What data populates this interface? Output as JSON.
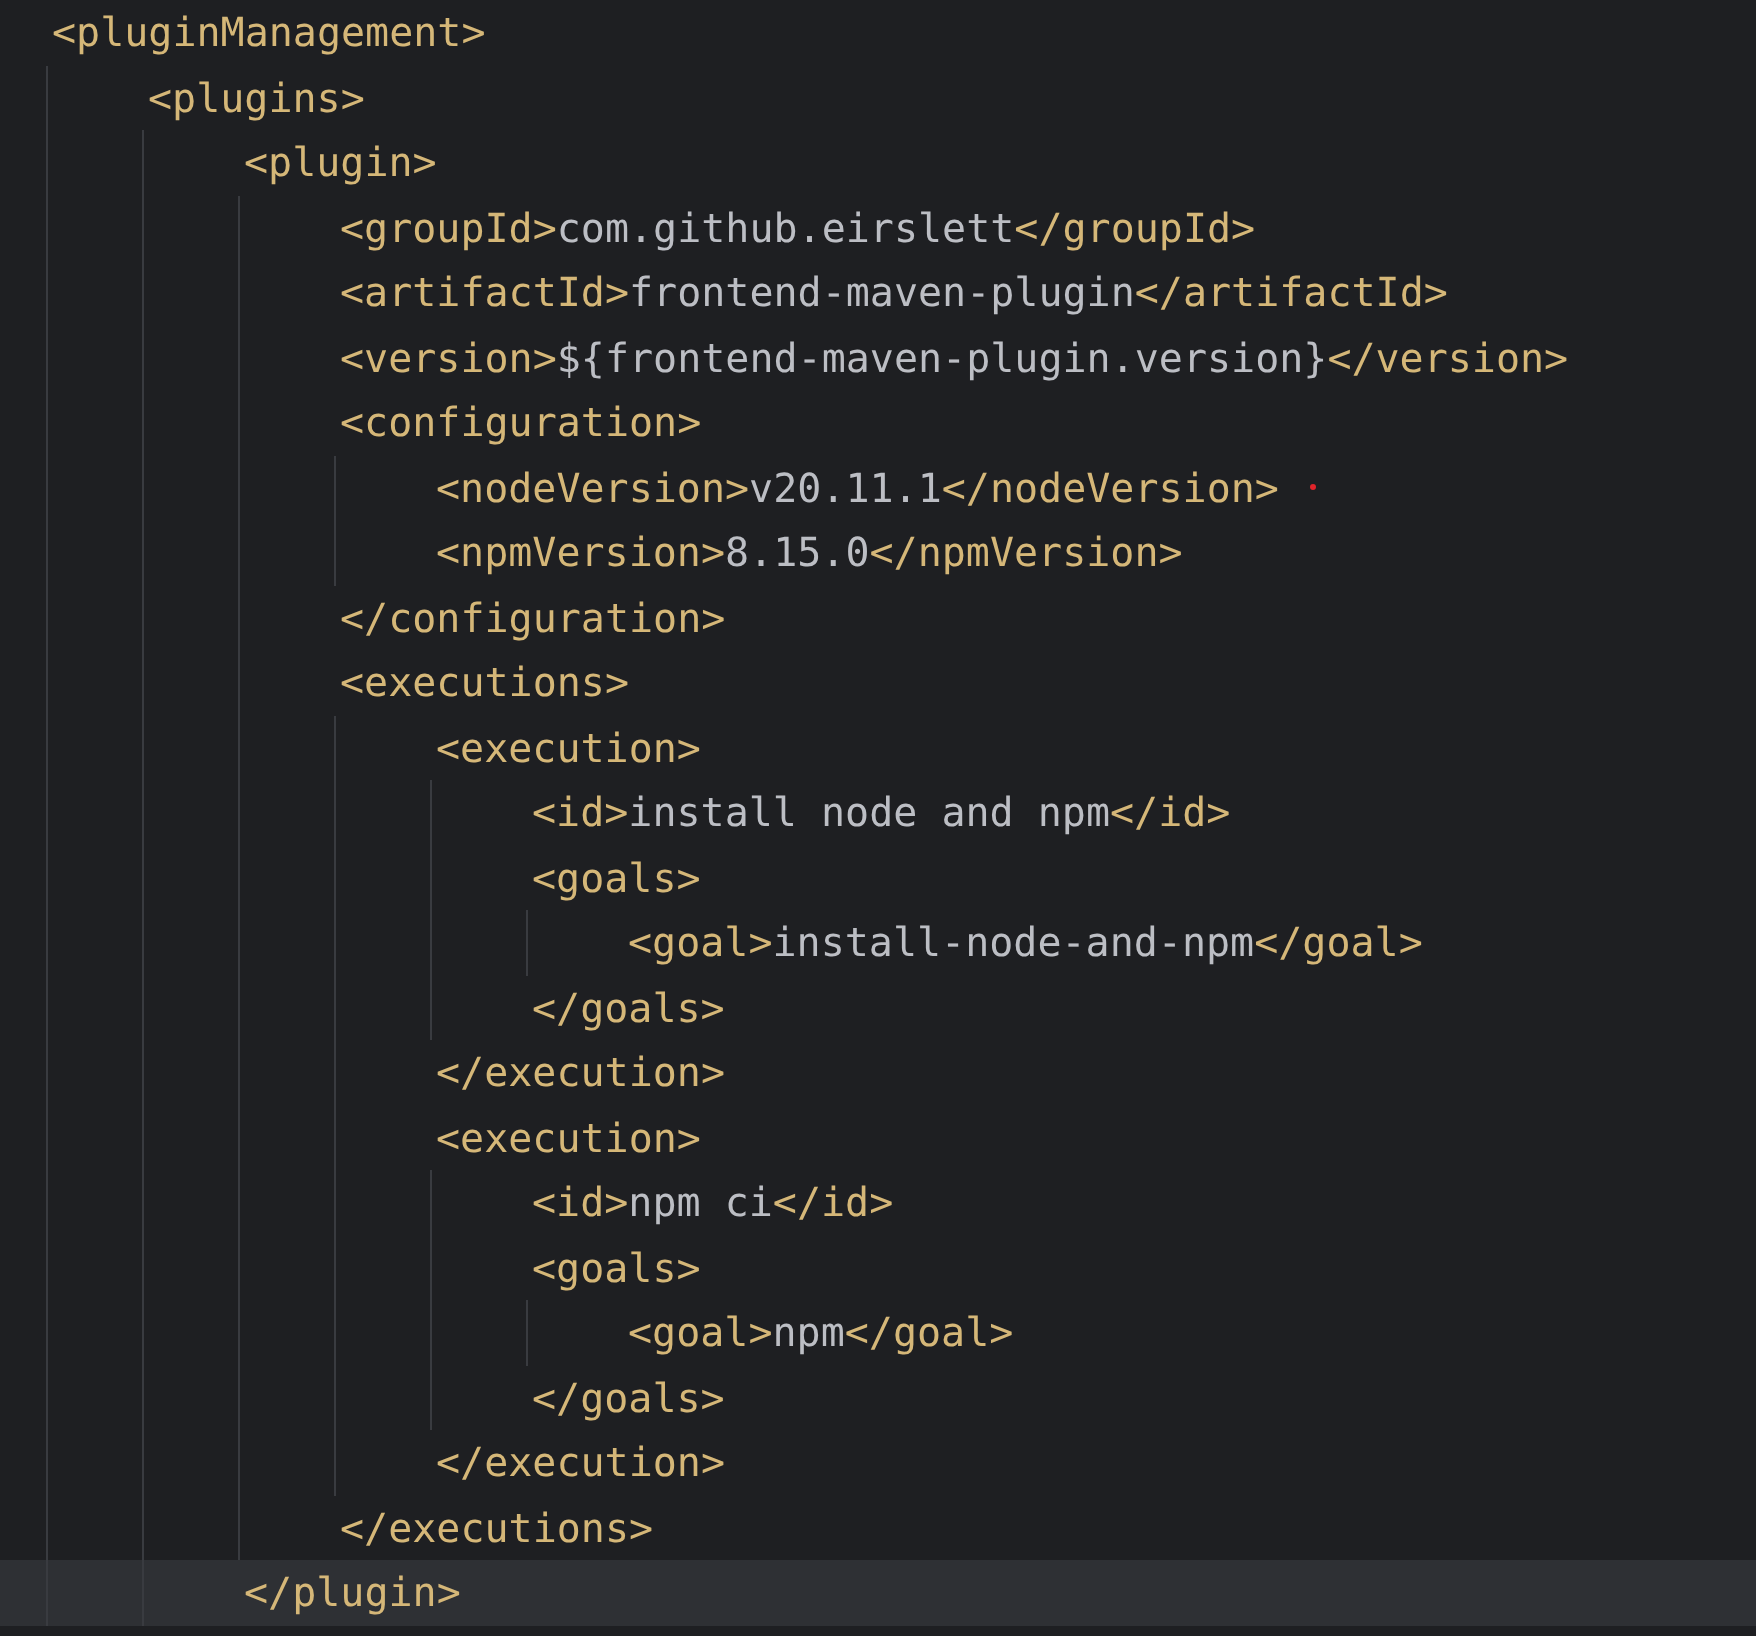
{
  "editor": {
    "tree": [
      {
        "open": "<pluginManagement>",
        "children": [
          {
            "open": "<plugins>",
            "children": [
              {
                "open": "<plugin>",
                "close": "</plugin>",
                "close_highlighted": true,
                "children": [
                  {
                    "open": "<groupId>",
                    "value": "com.github.eirslett",
                    "close": "</groupId>"
                  },
                  {
                    "open": "<artifactId>",
                    "value": "frontend-maven-plugin",
                    "close": "</artifactId>"
                  },
                  {
                    "open": "<version>",
                    "value": "${frontend-maven-plugin.version}",
                    "close": "</version>"
                  },
                  {
                    "open": "<configuration>",
                    "close": "</configuration>",
                    "close_highlighted": false,
                    "children": [
                      {
                        "open": "<nodeVersion>",
                        "value": "v20.11.1",
                        "close": "</nodeVersion>",
                        "error_marker": true
                      },
                      {
                        "open": "<npmVersion>",
                        "value": "8.15.0",
                        "close": "</npmVersion>",
                        "error_marker": false
                      }
                    ]
                  },
                  {
                    "open": "<executions>",
                    "close": "</executions>",
                    "close_highlighted": false,
                    "children": [
                      {
                        "open": "<execution>",
                        "close": "</execution>",
                        "close_highlighted": false,
                        "children": [
                          {
                            "open": "<id>",
                            "value": "install node and npm",
                            "close": "</id>"
                          },
                          {
                            "open": "<goals>",
                            "close": "</goals>",
                            "close_highlighted": false,
                            "children": [
                              {
                                "open": "<goal>",
                                "value": "install-node-and-npm",
                                "close": "</goal>"
                              }
                            ]
                          }
                        ]
                      },
                      {
                        "open": "<execution>",
                        "close": "</execution>",
                        "close_highlighted": false,
                        "children": [
                          {
                            "open": "<id>",
                            "value": "npm ci",
                            "close": "</id>"
                          },
                          {
                            "open": "<goals>",
                            "close": "</goals>",
                            "close_highlighted": false,
                            "children": [
                              {
                                "open": "<goal>",
                                "value": "npm",
                                "close": "</goal>"
                              }
                            ]
                          }
                        ]
                      }
                    ]
                  }
                ]
              }
            ]
          }
        ]
      }
    ]
  }
}
